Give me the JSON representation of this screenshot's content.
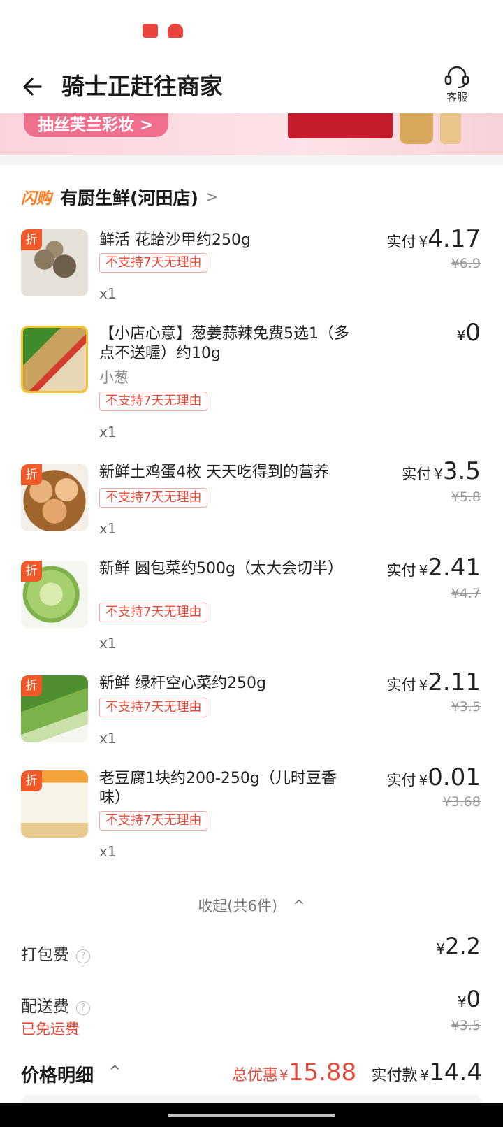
{
  "header": {
    "title": "骑士正赶往商家",
    "service_label": "客服"
  },
  "banner": {
    "pill_text": "抽丝芙兰彩妆 >"
  },
  "shop": {
    "tag": "闪购",
    "name": "有厨生鲜(河田店)",
    "arrow": ">"
  },
  "items": [
    {
      "name": "鲜活 花蛤沙甲约250g",
      "spec": "",
      "badge": "折",
      "tag": "不支持7天无理由",
      "qty": "x1",
      "paid_label": "实付",
      "yen": "¥",
      "price": "4.17",
      "original_price": "¥6.9"
    },
    {
      "name": "【小店心意】葱姜蒜辣免费5选1（多点不送喔）约10g",
      "spec": "小葱",
      "badge": "",
      "tag": "不支持7天无理由",
      "qty": "x1",
      "paid_label": "",
      "yen": "¥",
      "price": "0",
      "original_price": ""
    },
    {
      "name": "新鲜土鸡蛋4枚 天天吃得到的营养",
      "spec": "",
      "badge": "折",
      "tag": "不支持7天无理由",
      "qty": "x1",
      "paid_label": "实付",
      "yen": "¥",
      "price": "3.5",
      "original_price": "¥5.8"
    },
    {
      "name": "新鲜 圆包菜约500g（太大会切半）",
      "spec": "",
      "badge": "折",
      "tag": "不支持7天无理由",
      "qty": "x1",
      "paid_label": "实付",
      "yen": "¥",
      "price": "2.41",
      "original_price": "¥4.7"
    },
    {
      "name": "新鲜 绿杆空心菜约250g",
      "spec": "",
      "badge": "折",
      "tag": "不支持7天无理由",
      "qty": "x1",
      "paid_label": "实付",
      "yen": "¥",
      "price": "2.11",
      "original_price": "¥3.5"
    },
    {
      "name": "老豆腐1块约200-250g（儿时豆香味）",
      "spec": "",
      "badge": "折",
      "tag": "不支持7天无理由",
      "qty": "x1",
      "paid_label": "实付",
      "yen": "¥",
      "price": "0.01",
      "original_price": "¥3.68"
    }
  ],
  "collapse": {
    "label": "收起(共6件)",
    "chevron": "^"
  },
  "fees": {
    "packing_label": "打包费",
    "packing_yen": "¥",
    "packing_value": "2.2",
    "delivery_label": "配送费",
    "delivery_yen": "¥",
    "delivery_value": "0",
    "delivery_original": "¥3.5",
    "free_note": "已免运费",
    "help_glyph": "?"
  },
  "summary": {
    "detail_label": "价格明细",
    "detail_chevron": "^",
    "discount_label": "总优惠",
    "discount_yen": "¥",
    "discount_value": "15.88",
    "pay_label": "实付款",
    "pay_yen": "¥",
    "pay_value": "14.4"
  },
  "colors": {
    "accent_red": "#e5493a",
    "flash_orange": "#ff7a1a",
    "badge_orange": "#f05a2a",
    "banner_pink": "#ef6f8d"
  }
}
